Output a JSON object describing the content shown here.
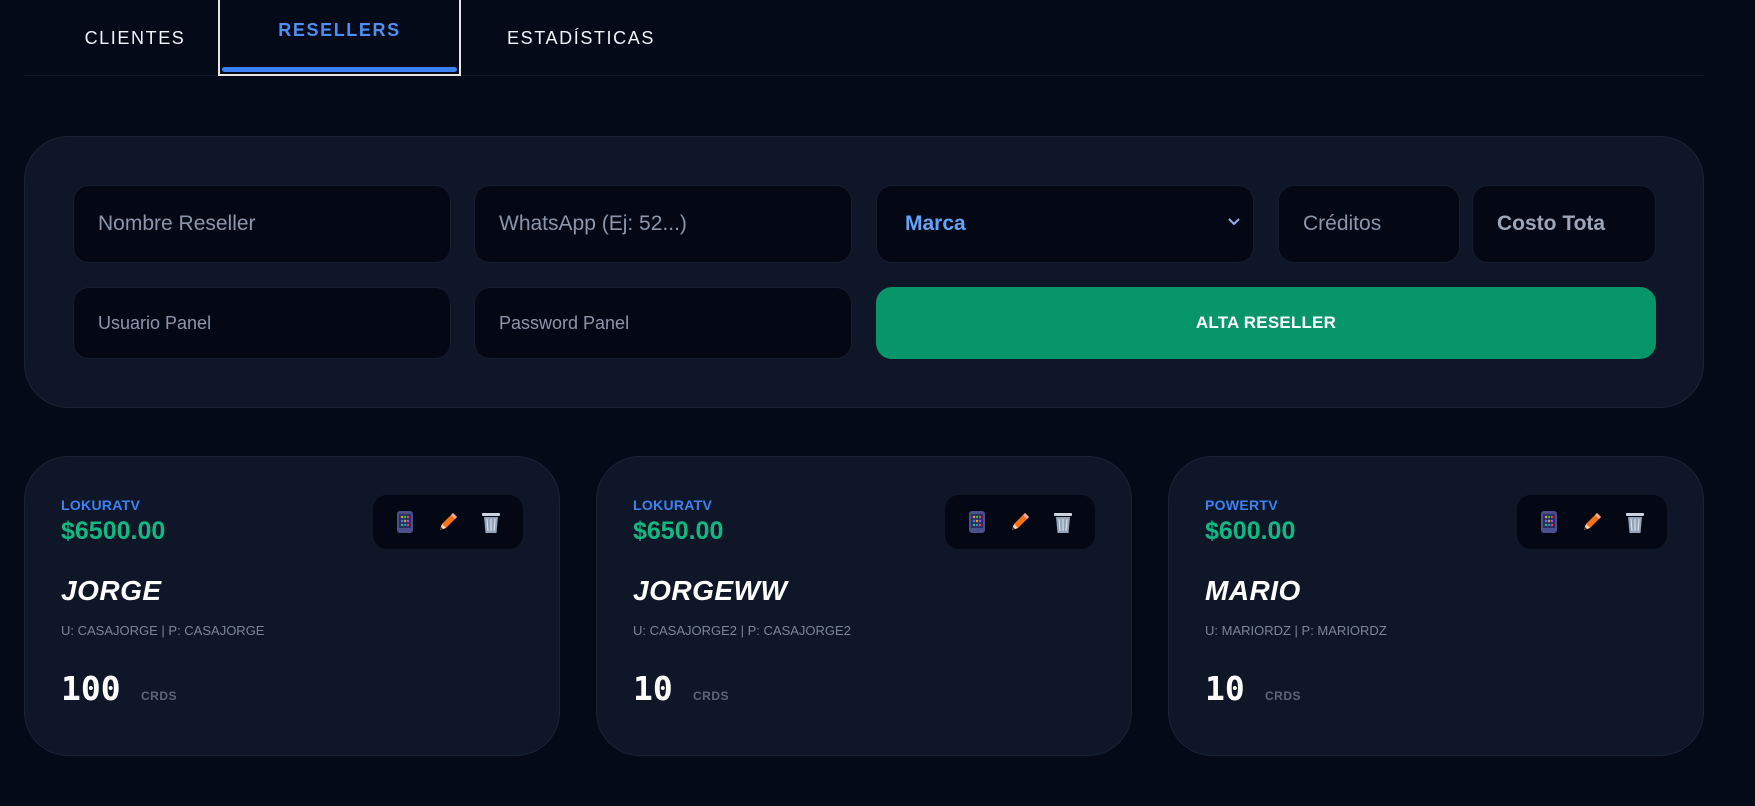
{
  "tabs": [
    {
      "label": "CLIENTES"
    },
    {
      "label": "RESELLERS",
      "active": true
    },
    {
      "label": "ESTADÍSTICAS"
    }
  ],
  "form": {
    "name_placeholder": "Nombre Reseller",
    "whatsapp_placeholder": "WhatsApp (Ej: 52...)",
    "marca_value": "Marca",
    "creditos_placeholder": "Créditos",
    "costo_value": "Costo Tota",
    "usuario_placeholder": "Usuario Panel",
    "password_placeholder": "Password Panel",
    "submit_label": "ALTA RESELLER"
  },
  "resellers": [
    {
      "brand": "LOKURATV",
      "price": "$6500.00",
      "name": "JORGE",
      "credentials": "U: CASAJORGE | P: CASAJORGE",
      "credits": "100",
      "unit": "CRDS"
    },
    {
      "brand": "LOKURATV",
      "price": "$650.00",
      "name": "JORGEWW",
      "credentials": "U: CASAJORGE2 | P: CASAJORGE2",
      "credits": "10",
      "unit": "CRDS"
    },
    {
      "brand": "POWERTV",
      "price": "$600.00",
      "name": "MARIO",
      "credentials": "U: MARIORDZ | P: MARIORDZ",
      "credits": "10",
      "unit": "CRDS"
    }
  ],
  "icons": [
    "phone-icon",
    "pencil-icon",
    "trash-icon"
  ],
  "colors": {
    "background": "#050a18",
    "panel": "#0e1628",
    "accent": "#3b82f6",
    "green": "#10b981",
    "button": "#07956a"
  }
}
